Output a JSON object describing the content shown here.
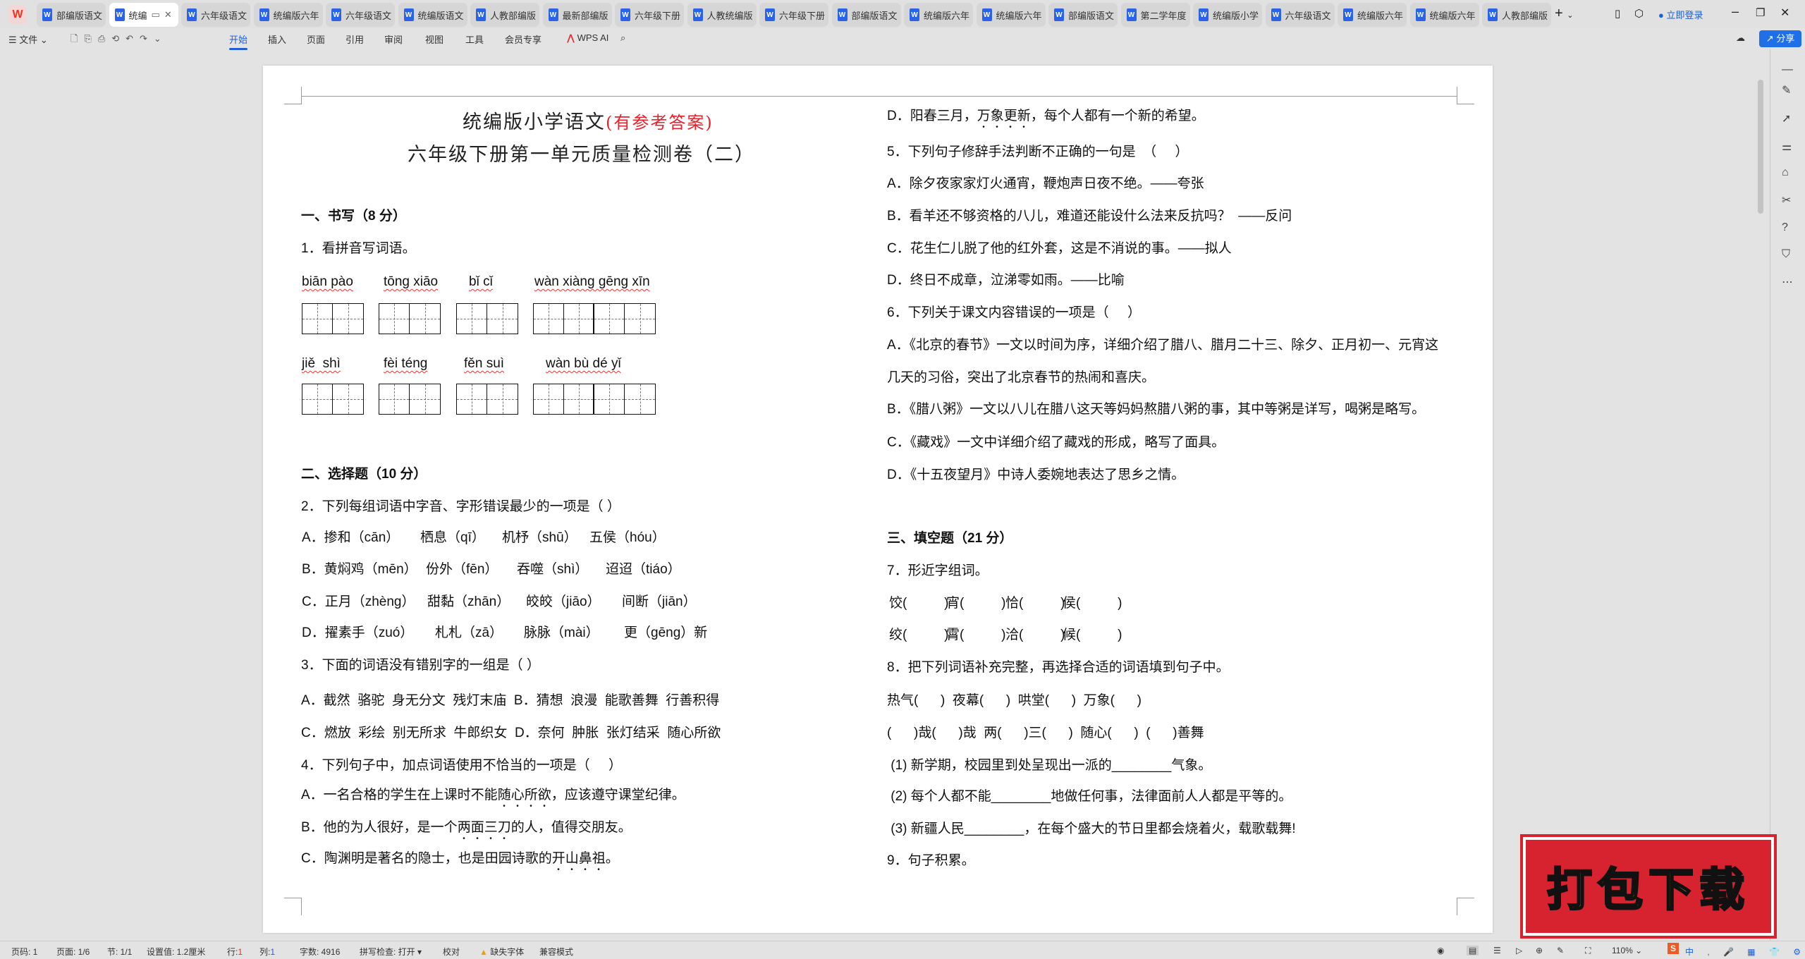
{
  "app": {
    "logo": "W",
    "login": "立即登录",
    "share": "分享"
  },
  "tabs": [
    "部编版语文",
    "统编",
    "六年级语文",
    "统编版六年",
    "六年级语文",
    "统编版语文",
    "人教部编版",
    "最新部编版",
    "六年级下册",
    "人教统编版",
    "六年级下册",
    "部编版语文",
    "统编版六年",
    "统编版六年",
    "部编版语文",
    "第二学年度",
    "统编版小学",
    "六年级语文",
    "统编版六年",
    "统编版六年",
    "人教部编版"
  ],
  "active_tab": 1,
  "toolbar": {
    "file": "文件",
    "menus": [
      "开始",
      "插入",
      "页面",
      "引用",
      "审阅",
      "视图",
      "工具",
      "会员专享"
    ],
    "wps_ai": "WPS AI"
  },
  "doc": {
    "title1": "统编版小学语文",
    "title1_red": "(有参考答案)",
    "title2": "六年级下册第一单元质量检测卷（二）",
    "sec1": "一、书写（8 分）",
    "q1": "1．看拼音写词语。",
    "pinyin1": [
      "biān pào",
      "tōng xiāo",
      "bǐ cǐ",
      "wàn xiàng gēng xīn"
    ],
    "pinyin2": [
      "jiě  shì",
      "fèi téng",
      "fěn suì",
      "wàn bù dé yǐ"
    ],
    "sec2": "二、选择题（10 分）",
    "q2": "2．下列每组词语中字音、字形错误最少的一项是（ ）",
    "q2_opts": [
      [
        "A．掺和（cān）",
        "栖息（qī）",
        "机杼（shū）",
        "五侯（hóu）"
      ],
      [
        "B．黄焖鸡（mēn）",
        "份外（fēn）",
        "吞噬（shì）",
        "迢迢（tiáo）"
      ],
      [
        "C．正月（zhèng）",
        "甜黏（zhān）",
        "皎皎（jiāo）",
        "间断（jiān）"
      ],
      [
        "D．擢素手（zuó）",
        "札札（zā）",
        "脉脉（mài）",
        "更（gēng）新"
      ]
    ],
    "q3": "3．下面的词语没有错别字的一组是（ ）",
    "q3_ab": "A．截然  骆驼  身无分文  残灯末庙  B．猜想  浪漫  能歌善舞  行善积得",
    "q3_cd": "C．燃放  彩绘  别无所求  牛郎织女  D．奈何  肿胀  张灯结采  随心所欲",
    "q4": "4．下列句子中，加点词语使用不恰当的一项是（     ）",
    "q4_a": [
      "A．一名合格的学生在上课时不能",
      "随心所欲",
      "，应该遵守课堂纪律。"
    ],
    "q4_b": [
      "B．他的为人很好，是一个",
      "两面三刀",
      "的人，值得交朋友。"
    ],
    "q4_c": [
      "C．陶渊明是著名的隐士，也是田园诗歌的",
      "开山鼻祖",
      "。"
    ],
    "q4_d": [
      "D．阳春三月，",
      "万象更新",
      "，每个人都有一个新的希望。"
    ],
    "q5": "5．下列句子修辞手法判断不正确的一句是  （     ）",
    "q5_opts": [
      "A．除夕夜家家灯火通宵，鞭炮声日夜不绝。——夸张",
      "B．看羊还不够资格的八儿，难道还能设什么法来反抗吗？  ——反问",
      "C．花生仁儿脱了他的红外套，这是不消说的事。——拟人",
      "D．终日不成章，泣涕零如雨。——比喻"
    ],
    "q6": "6．下列关于课文内容错误的一项是（     ）",
    "q6_opts": [
      "A．《北京的春节》一文以时间为序，详细介绍了腊八、腊月二十三、除夕、正月初一、元宵这",
      "几天的习俗，突出了北京春节的热闹和喜庆。",
      "B．《腊八粥》一文以八儿在腊八这天等妈妈熬腊八粥的事，其中等粥是详写，喝粥是略写。",
      "C．《藏戏》一文中详细介绍了藏戏的形成，略写了面具。",
      "D．《十五夜望月》中诗人委婉地表达了思乡之情。"
    ],
    "sec3": "三、填空题（21 分）",
    "q7": "7．形近字组词。",
    "q7_row1": [
      "饺(          )",
      "宵(          )",
      "恰(          )",
      "侯(          )"
    ],
    "q7_row2": [
      "绞(          )",
      "霄(          )",
      "洽(          )",
      "候(          )"
    ],
    "q8": "8．把下列词语补充完整，再选择合适的词语填到句子中。",
    "q8_row1": "热气(      )  夜幕(      )  哄堂(      )  万象(      )",
    "q8_row2": "(      )哉(      )哉  两(      )三(      )  随心(      )  (      )善舞",
    "q8_subs": [
      " (1) 新学期，校园里到处呈现出一派的________气象。",
      " (2) 每个人都不能________地做任何事，法律面前人人都是平等的。",
      " (3) 新疆人民________，在每个盛大的节日里都会烧着火，载歌载舞!"
    ],
    "q9": "9．句子积累。"
  },
  "status": {
    "page_num": "页码: 1",
    "pages": "页面: 1/6",
    "section": "节: 1/1",
    "setting": "设置值: 1.2厘米",
    "row_label": "行:",
    "row": "1",
    "col_label": "列:",
    "col": "1",
    "words": "字数: 4916",
    "spell": "拼写检查: 打开 ▾",
    "proof": "校对",
    "missing_font": "缺失字体",
    "compat": "兼容模式",
    "zoom": "110%"
  },
  "banner": "打包下载",
  "colors": {
    "accent": "#1f5fd6",
    "title_red": "#e8202a",
    "banner_red": "#d6232f",
    "banner_text": "#fff200"
  }
}
